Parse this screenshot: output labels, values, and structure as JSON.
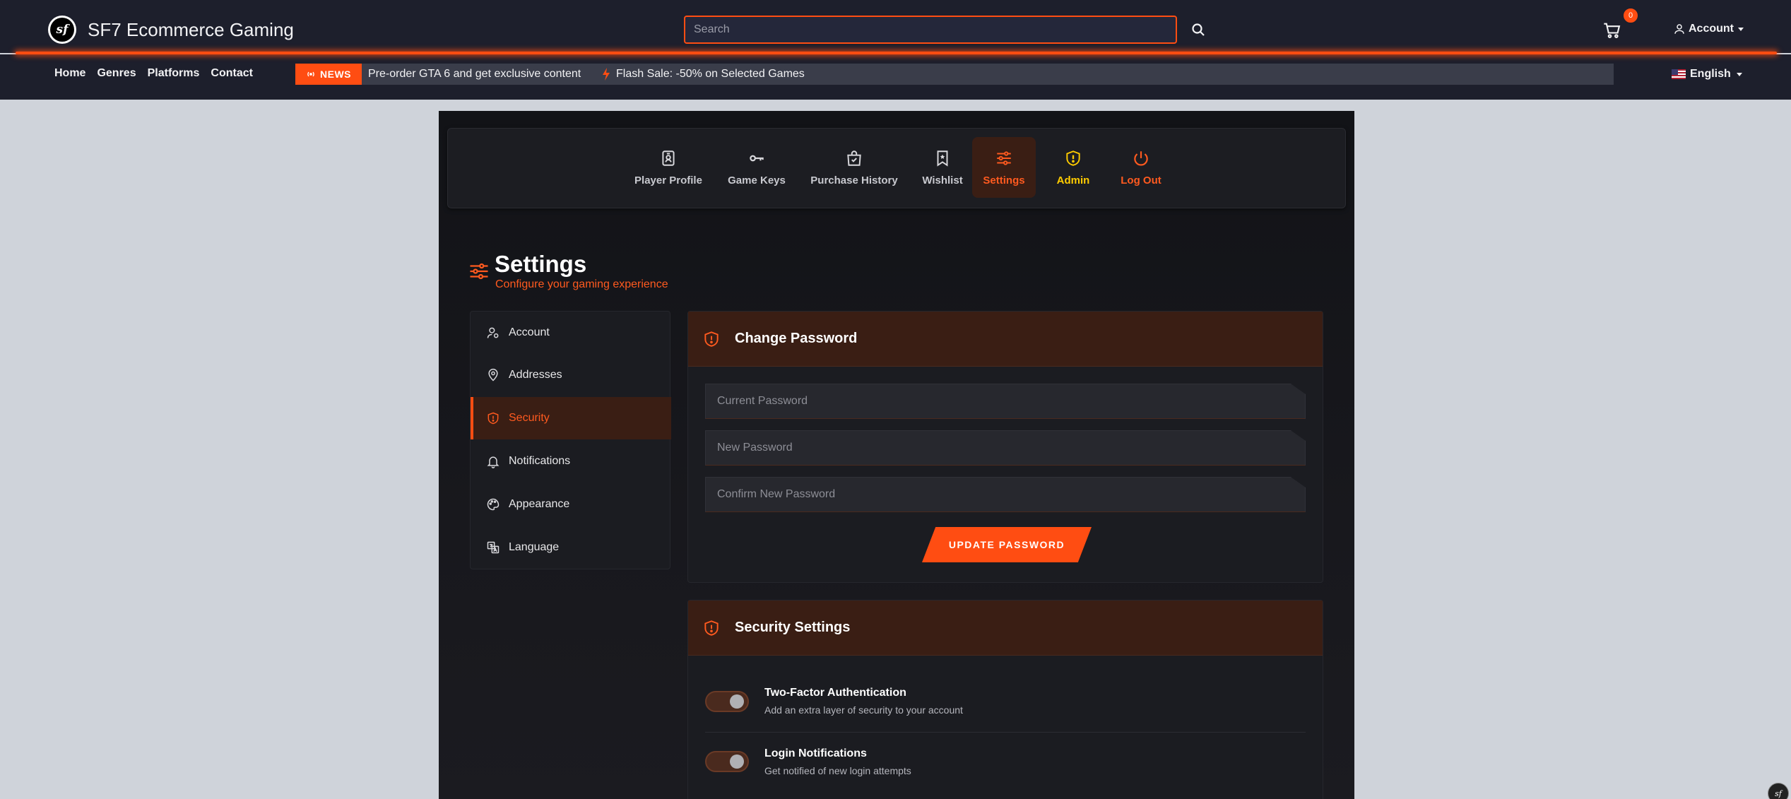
{
  "header": {
    "brand": "SF7 Ecommerce Gaming",
    "logo_text": "sf",
    "search_placeholder": "Search",
    "cart_count": "0",
    "account_label": "Account"
  },
  "nav": {
    "links": [
      "Home",
      "Genres",
      "Platforms",
      "Contact"
    ],
    "news_badge": "NEWS",
    "news_text": "Pre-order GTA 6 and get exclusive content",
    "flash_text": "Flash Sale: -50% on Selected Games",
    "language": "English"
  },
  "tabs": [
    {
      "label": "Player Profile",
      "icon": "id-badge-icon"
    },
    {
      "label": "Game Keys",
      "icon": "key-icon"
    },
    {
      "label": "Purchase History",
      "icon": "shopping-bag-icon"
    },
    {
      "label": "Wishlist",
      "icon": "bookmark-star-icon"
    },
    {
      "label": "Settings",
      "icon": "sliders-icon",
      "active": true
    },
    {
      "label": "Admin",
      "icon": "shield-icon"
    },
    {
      "label": "Log Out",
      "icon": "power-icon"
    }
  ],
  "page": {
    "title": "Settings",
    "subtitle": "Configure your gaming experience"
  },
  "sidebar": {
    "items": [
      {
        "label": "Account",
        "icon": "user-gear-icon"
      },
      {
        "label": "Addresses",
        "icon": "map-pin-icon"
      },
      {
        "label": "Security",
        "icon": "shield-icon",
        "active": true
      },
      {
        "label": "Notifications",
        "icon": "bell-icon"
      },
      {
        "label": "Appearance",
        "icon": "palette-icon"
      },
      {
        "label": "Language",
        "icon": "translate-icon"
      }
    ]
  },
  "change_password": {
    "title": "Change Password",
    "current_placeholder": "Current Password",
    "new_placeholder": "New Password",
    "confirm_placeholder": "Confirm New Password",
    "button": "UPDATE PASSWORD"
  },
  "security_settings": {
    "title": "Security Settings",
    "items": [
      {
        "title": "Two-Factor Authentication",
        "desc": "Add an extra layer of security to your account",
        "enabled": true
      },
      {
        "title": "Login Notifications",
        "desc": "Get notified of new login attempts",
        "enabled": true
      }
    ]
  },
  "colors": {
    "accent": "#ff4d12",
    "header_bg": "#1d1f2c",
    "admin": "#ffcc00",
    "active_bg": "#3a1e14"
  }
}
